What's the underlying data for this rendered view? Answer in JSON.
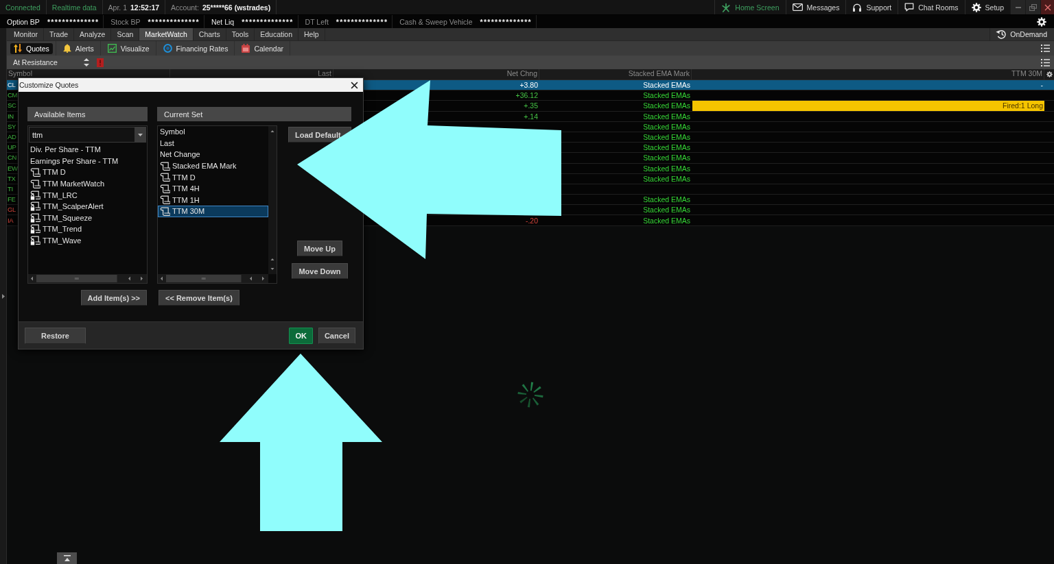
{
  "status_bar": {
    "connection": "Connected",
    "feed": "Realtime data",
    "date": "Apr. 1",
    "time": "12:52:17",
    "account_label": "Account:",
    "account": "25*****66 (wstrades)",
    "links": [
      {
        "label": "Home Screen",
        "kind": "home"
      },
      {
        "label": "Messages",
        "kind": "messages"
      },
      {
        "label": "Support",
        "kind": "support"
      },
      {
        "label": "Chat Rooms",
        "kind": "chat"
      },
      {
        "label": "Setup",
        "kind": "setup"
      }
    ]
  },
  "balances": [
    {
      "label": "Option BP",
      "value": "**************",
      "dropdown": true
    },
    {
      "label": "Stock BP",
      "value": "**************",
      "dropdown": false
    },
    {
      "label": "Net Liq",
      "value": "**************",
      "dropdown": true
    },
    {
      "label": "DT Left",
      "value": "**************",
      "dropdown": false
    },
    {
      "label": "Cash & Sweep Vehicle",
      "value": "**************",
      "dropdown": false
    }
  ],
  "menu": [
    {
      "label": "Monitor",
      "selected": false
    },
    {
      "label": "Trade",
      "selected": false
    },
    {
      "label": "Analyze",
      "selected": false
    },
    {
      "label": "Scan",
      "selected": false
    },
    {
      "label": "MarketWatch",
      "selected": true
    },
    {
      "label": "Charts",
      "selected": false
    },
    {
      "label": "Tools",
      "selected": false
    },
    {
      "label": "Education",
      "selected": false
    },
    {
      "label": "Help",
      "selected": false
    }
  ],
  "on_demand": "OnDemand",
  "subtabs": [
    {
      "label": "Quotes",
      "kind": "quotes",
      "selected": true
    },
    {
      "label": "Alerts",
      "kind": "alerts",
      "selected": false
    },
    {
      "label": "Visualize",
      "kind": "visualize",
      "selected": false
    },
    {
      "label": "Financing Rates",
      "kind": "rates",
      "selected": false
    },
    {
      "label": "Calendar",
      "kind": "calendar",
      "selected": false
    }
  ],
  "watchlist": {
    "name": "At Resistance"
  },
  "table": {
    "columns": [
      "Symbol",
      "Last",
      "Net Chng",
      "Stacked EMA Mark",
      "TTM 30M"
    ],
    "rows": [
      {
        "symbol": "CL",
        "net_change": "+3.80",
        "ema_mark": "Stacked EMAs",
        "ttm_30m": "-",
        "negative": false,
        "selected": true,
        "highlighted": false
      },
      {
        "symbol": "CM",
        "net_change": "+36.12",
        "ema_mark": "Stacked EMAs",
        "negative": false,
        "selected": false,
        "highlighted": false
      },
      {
        "symbol": "SC",
        "net_change": "+.35",
        "ema_mark": "Stacked EMAs",
        "ttm_30m": "Fired:1 Long",
        "negative": false,
        "selected": false,
        "highlighted": true
      },
      {
        "symbol": "IN",
        "net_change": "+.14",
        "ema_mark": "Stacked EMAs",
        "negative": false,
        "selected": false,
        "highlighted": false
      },
      {
        "symbol": "SY",
        "ema_mark": "Stacked EMAs",
        "negative": false,
        "selected": false,
        "highlighted": false
      },
      {
        "symbol": "AD",
        "ema_mark": "Stacked EMAs",
        "negative": false,
        "selected": false,
        "highlighted": false
      },
      {
        "symbol": "UP",
        "ema_mark": "Stacked EMAs",
        "negative": false,
        "selected": false,
        "highlighted": false
      },
      {
        "symbol": "CN",
        "ema_mark": "Stacked EMAs",
        "negative": false,
        "selected": false,
        "highlighted": false
      },
      {
        "symbol": "EW",
        "ema_mark": "Stacked EMAs",
        "negative": false,
        "selected": false,
        "highlighted": false
      },
      {
        "symbol": "TX",
        "ema_mark": "Stacked EMAs",
        "negative": false,
        "selected": false,
        "highlighted": false
      },
      {
        "symbol": "TI",
        "negative": false,
        "selected": false,
        "highlighted": false
      },
      {
        "symbol": "FE",
        "ema_mark": "Stacked EMAs",
        "negative": false,
        "selected": false,
        "highlighted": false
      },
      {
        "symbol": "GL",
        "ema_mark": "Stacked EMAs",
        "negative": true,
        "selected": false,
        "highlighted": false
      },
      {
        "symbol": "IA",
        "net_change": "-.20",
        "ema_mark": "Stacked EMAs",
        "negative": true,
        "selected": false,
        "highlighted": false
      }
    ]
  },
  "dialog": {
    "title": "Customize Quotes",
    "available": {
      "heading": "Available Items",
      "filter": "ttm",
      "items": [
        {
          "label": "Div. Per Share - TTM",
          "kind": "field",
          "selected": false
        },
        {
          "label": "Earnings Per Share - TTM",
          "kind": "field",
          "selected": false
        },
        {
          "label": "TTM D",
          "kind": "study",
          "selected": false
        },
        {
          "label": "TTM MarketWatch",
          "kind": "study",
          "selected": false
        },
        {
          "label": "TTM_LRC",
          "kind": "locked_study",
          "selected": false
        },
        {
          "label": "TTM_ScalperAlert",
          "kind": "locked_study",
          "selected": false
        },
        {
          "label": "TTM_Squeeze",
          "kind": "locked_study",
          "selected": false
        },
        {
          "label": "TTM_Trend",
          "kind": "locked_study",
          "selected": false
        },
        {
          "label": "TTM_Wave",
          "kind": "locked_study",
          "selected": false
        }
      ]
    },
    "current_set": {
      "heading": "Current Set",
      "items": [
        {
          "label": "Symbol",
          "kind": "field",
          "selected": false
        },
        {
          "label": "Last",
          "kind": "field",
          "selected": false
        },
        {
          "label": "Net Change",
          "kind": "field",
          "selected": false
        },
        {
          "label": "Stacked EMA Mark",
          "kind": "study",
          "selected": false
        },
        {
          "label": "TTM D",
          "kind": "study",
          "selected": false
        },
        {
          "label": "TTM 4H",
          "kind": "study",
          "selected": false
        },
        {
          "label": "TTM 1H",
          "kind": "study",
          "selected": false
        },
        {
          "label": "TTM 30M",
          "kind": "study",
          "selected": true
        }
      ]
    },
    "side_buttons": [
      "Load Default",
      "Move Up",
      "Move Down"
    ],
    "add_button": "Add Item(s) >>",
    "remove_button": "<< Remove Item(s)",
    "footer_buttons": [
      {
        "label": "Restore",
        "kind": "secondary"
      },
      {
        "label": "OK",
        "kind": "primary"
      },
      {
        "label": "Cancel",
        "kind": "secondary"
      }
    ]
  }
}
